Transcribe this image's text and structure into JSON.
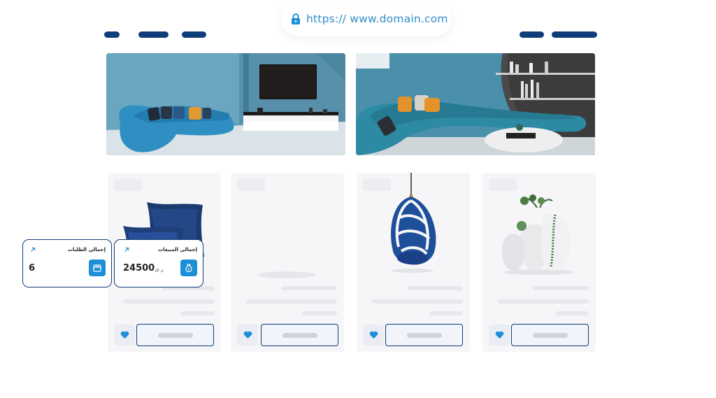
{
  "browser": {
    "url": "https:// www.domain.com"
  },
  "colors": {
    "navy": "#0e3d7a",
    "accent": "#1c8fd6",
    "url_text": "#2f8ec9"
  },
  "stats": [
    {
      "title": "إجمالي الطلبات",
      "value": "6",
      "unit": "",
      "icon": "box-icon"
    },
    {
      "title": "إجمالي المبيعات",
      "value": "24500",
      "unit": "ر.ي",
      "icon": "money-bag-icon"
    }
  ],
  "products": [
    {
      "name": "navy-pillows",
      "icon": "pillow-image"
    },
    {
      "name": "empty-placeholder",
      "icon": "placeholder-image"
    },
    {
      "name": "hanging-egg-chair",
      "icon": "chair-image"
    },
    {
      "name": "white-vases",
      "icon": "vase-image"
    }
  ]
}
